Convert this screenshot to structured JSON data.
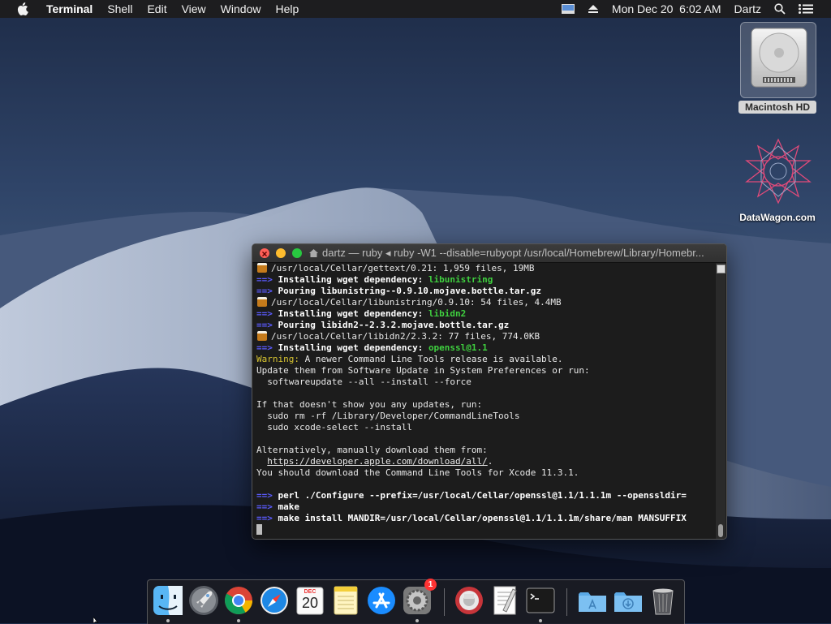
{
  "menubar": {
    "apple_icon": "apple-logo",
    "app_name": "Terminal",
    "menus": [
      "Shell",
      "Edit",
      "View",
      "Window",
      "Help"
    ],
    "clock": "Mon Dec 20  6:02 AM",
    "user": "Dartz"
  },
  "desktop": {
    "disk_label": "Macintosh HD",
    "app_label": "DataWagon.com"
  },
  "terminal": {
    "title": "dartz — ruby ◂ ruby -W1 --disable=rubyopt /usr/local/Homebrew/Library/Homebr...",
    "lines": [
      {
        "kind": "beer",
        "text": "/usr/local/Cellar/gettext/0.21: 1,959 files, 19MB"
      },
      {
        "kind": "dep",
        "prefix": "==>",
        "label": "Installing wget dependency: ",
        "name": "libunistring"
      },
      {
        "kind": "arrow",
        "prefix": "==>",
        "text": "Pouring libunistring--0.9.10.mojave.bottle.tar.gz"
      },
      {
        "kind": "beer",
        "text": "/usr/local/Cellar/libunistring/0.9.10: 54 files, 4.4MB"
      },
      {
        "kind": "dep",
        "prefix": "==>",
        "label": "Installing wget dependency: ",
        "name": "libidn2"
      },
      {
        "kind": "arrow",
        "prefix": "==>",
        "text": "Pouring libidn2--2.3.2.mojave.bottle.tar.gz"
      },
      {
        "kind": "beer",
        "text": "/usr/local/Cellar/libidn2/2.3.2: 77 files, 774.0KB"
      },
      {
        "kind": "dep",
        "prefix": "==>",
        "label": "Installing wget dependency: ",
        "name": "openssl@1.1"
      },
      {
        "kind": "warn",
        "warn": "Warning:",
        "text": " A newer Command Line Tools release is available."
      },
      {
        "kind": "plain",
        "text": "Update them from Software Update in System Preferences or run:"
      },
      {
        "kind": "plain",
        "text": "  softwareupdate --all --install --force"
      },
      {
        "kind": "plain",
        "text": ""
      },
      {
        "kind": "plain",
        "text": "If that doesn't show you any updates, run:"
      },
      {
        "kind": "plain",
        "text": "  sudo rm -rf /Library/Developer/CommandLineTools"
      },
      {
        "kind": "plain",
        "text": "  sudo xcode-select --install"
      },
      {
        "kind": "plain",
        "text": ""
      },
      {
        "kind": "plain",
        "text": "Alternatively, manually download them from:"
      },
      {
        "kind": "link",
        "indent": "  ",
        "url": "https://developer.apple.com/download/all/",
        "after": "."
      },
      {
        "kind": "plain",
        "text": "You should download the Command Line Tools for Xcode 11.3.1."
      },
      {
        "kind": "plain",
        "text": ""
      },
      {
        "kind": "arrow",
        "prefix": "==>",
        "text": "perl ./Configure --prefix=/usr/local/Cellar/openssl@1.1/1.1.1m --openssldir="
      },
      {
        "kind": "arrow",
        "prefix": "==>",
        "text": "make"
      },
      {
        "kind": "arrow",
        "prefix": "==>",
        "text": "make install MANDIR=/usr/local/Cellar/openssl@1.1/1.1.1m/share/man MANSUFFIX"
      }
    ]
  },
  "dock": {
    "calendar_month": "DEC",
    "calendar_day": "20",
    "sysprefs_badge": "1"
  }
}
